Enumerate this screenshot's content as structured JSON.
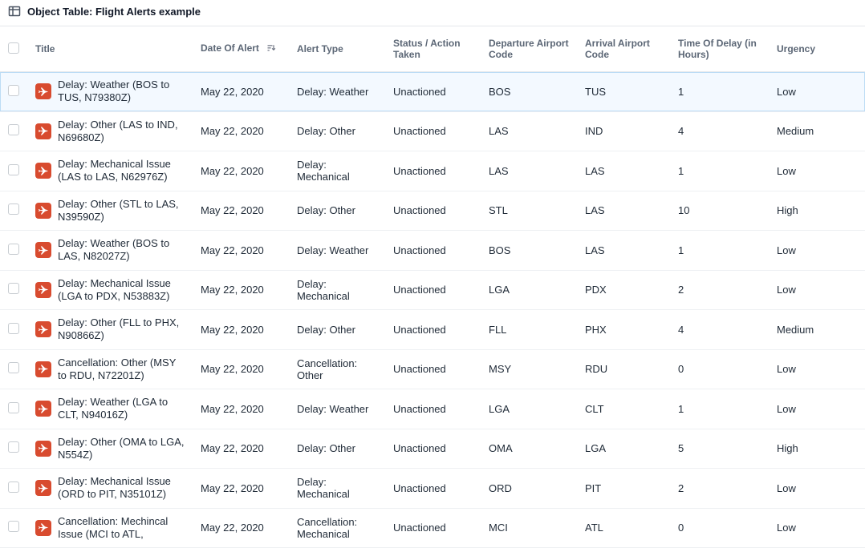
{
  "header": {
    "title": "Object Table: Flight Alerts example"
  },
  "columns": {
    "title": "Title",
    "date": "Date Of Alert",
    "type": "Alert Type",
    "status": "Status / Action Taken",
    "dep": "Departure Airport Code",
    "arr": "Arrival Airport Code",
    "delay": "Time Of Delay (in Hours)",
    "urg": "Urgency"
  },
  "rows": [
    {
      "selected": true,
      "title": "Delay: Weather (BOS to TUS, N79380Z)",
      "date": "May 22, 2020",
      "type": "Delay: Weather",
      "status": "Unactioned",
      "dep": "BOS",
      "arr": "TUS",
      "delay": "1",
      "urg": "Low"
    },
    {
      "selected": false,
      "title": "Delay: Other (LAS to IND, N69680Z)",
      "date": "May 22, 2020",
      "type": "Delay: Other",
      "status": "Unactioned",
      "dep": "LAS",
      "arr": "IND",
      "delay": "4",
      "urg": "Medium"
    },
    {
      "selected": false,
      "title": "Delay: Mechanical Issue (LAS to LAS, N62976Z)",
      "date": "May 22, 2020",
      "type": "Delay: Mechanical",
      "status": "Unactioned",
      "dep": "LAS",
      "arr": "LAS",
      "delay": "1",
      "urg": "Low"
    },
    {
      "selected": false,
      "title": "Delay: Other (STL to LAS, N39590Z)",
      "date": "May 22, 2020",
      "type": "Delay: Other",
      "status": "Unactioned",
      "dep": "STL",
      "arr": "LAS",
      "delay": "10",
      "urg": "High"
    },
    {
      "selected": false,
      "title": "Delay: Weather (BOS to LAS, N82027Z)",
      "date": "May 22, 2020",
      "type": "Delay: Weather",
      "status": "Unactioned",
      "dep": "BOS",
      "arr": "LAS",
      "delay": "1",
      "urg": "Low"
    },
    {
      "selected": false,
      "title": "Delay: Mechanical Issue (LGA to PDX, N53883Z)",
      "date": "May 22, 2020",
      "type": "Delay: Mechanical",
      "status": "Unactioned",
      "dep": "LGA",
      "arr": "PDX",
      "delay": "2",
      "urg": "Low"
    },
    {
      "selected": false,
      "title": "Delay: Other (FLL to PHX, N90866Z)",
      "date": "May 22, 2020",
      "type": "Delay: Other",
      "status": "Unactioned",
      "dep": "FLL",
      "arr": "PHX",
      "delay": "4",
      "urg": "Medium"
    },
    {
      "selected": false,
      "title": "Cancellation: Other (MSY to RDU, N72201Z)",
      "date": "May 22, 2020",
      "type": "Cancellation: Other",
      "status": "Unactioned",
      "dep": "MSY",
      "arr": "RDU",
      "delay": "0",
      "urg": "Low"
    },
    {
      "selected": false,
      "title": "Delay: Weather (LGA to CLT, N94016Z)",
      "date": "May 22, 2020",
      "type": "Delay: Weather",
      "status": "Unactioned",
      "dep": "LGA",
      "arr": "CLT",
      "delay": "1",
      "urg": "Low"
    },
    {
      "selected": false,
      "title": "Delay: Other (OMA to LGA, N554Z)",
      "date": "May 22, 2020",
      "type": "Delay: Other",
      "status": "Unactioned",
      "dep": "OMA",
      "arr": "LGA",
      "delay": "5",
      "urg": "High"
    },
    {
      "selected": false,
      "title": "Delay: Mechanical Issue (ORD to PIT, N35101Z)",
      "date": "May 22, 2020",
      "type": "Delay: Mechanical",
      "status": "Unactioned",
      "dep": "ORD",
      "arr": "PIT",
      "delay": "2",
      "urg": "Low"
    },
    {
      "selected": false,
      "title": "Cancellation: Mechincal Issue (MCI to ATL,",
      "date": "May 22, 2020",
      "type": "Cancellation: Mechanical",
      "status": "Unactioned",
      "dep": "MCI",
      "arr": "ATL",
      "delay": "0",
      "urg": "Low"
    }
  ]
}
